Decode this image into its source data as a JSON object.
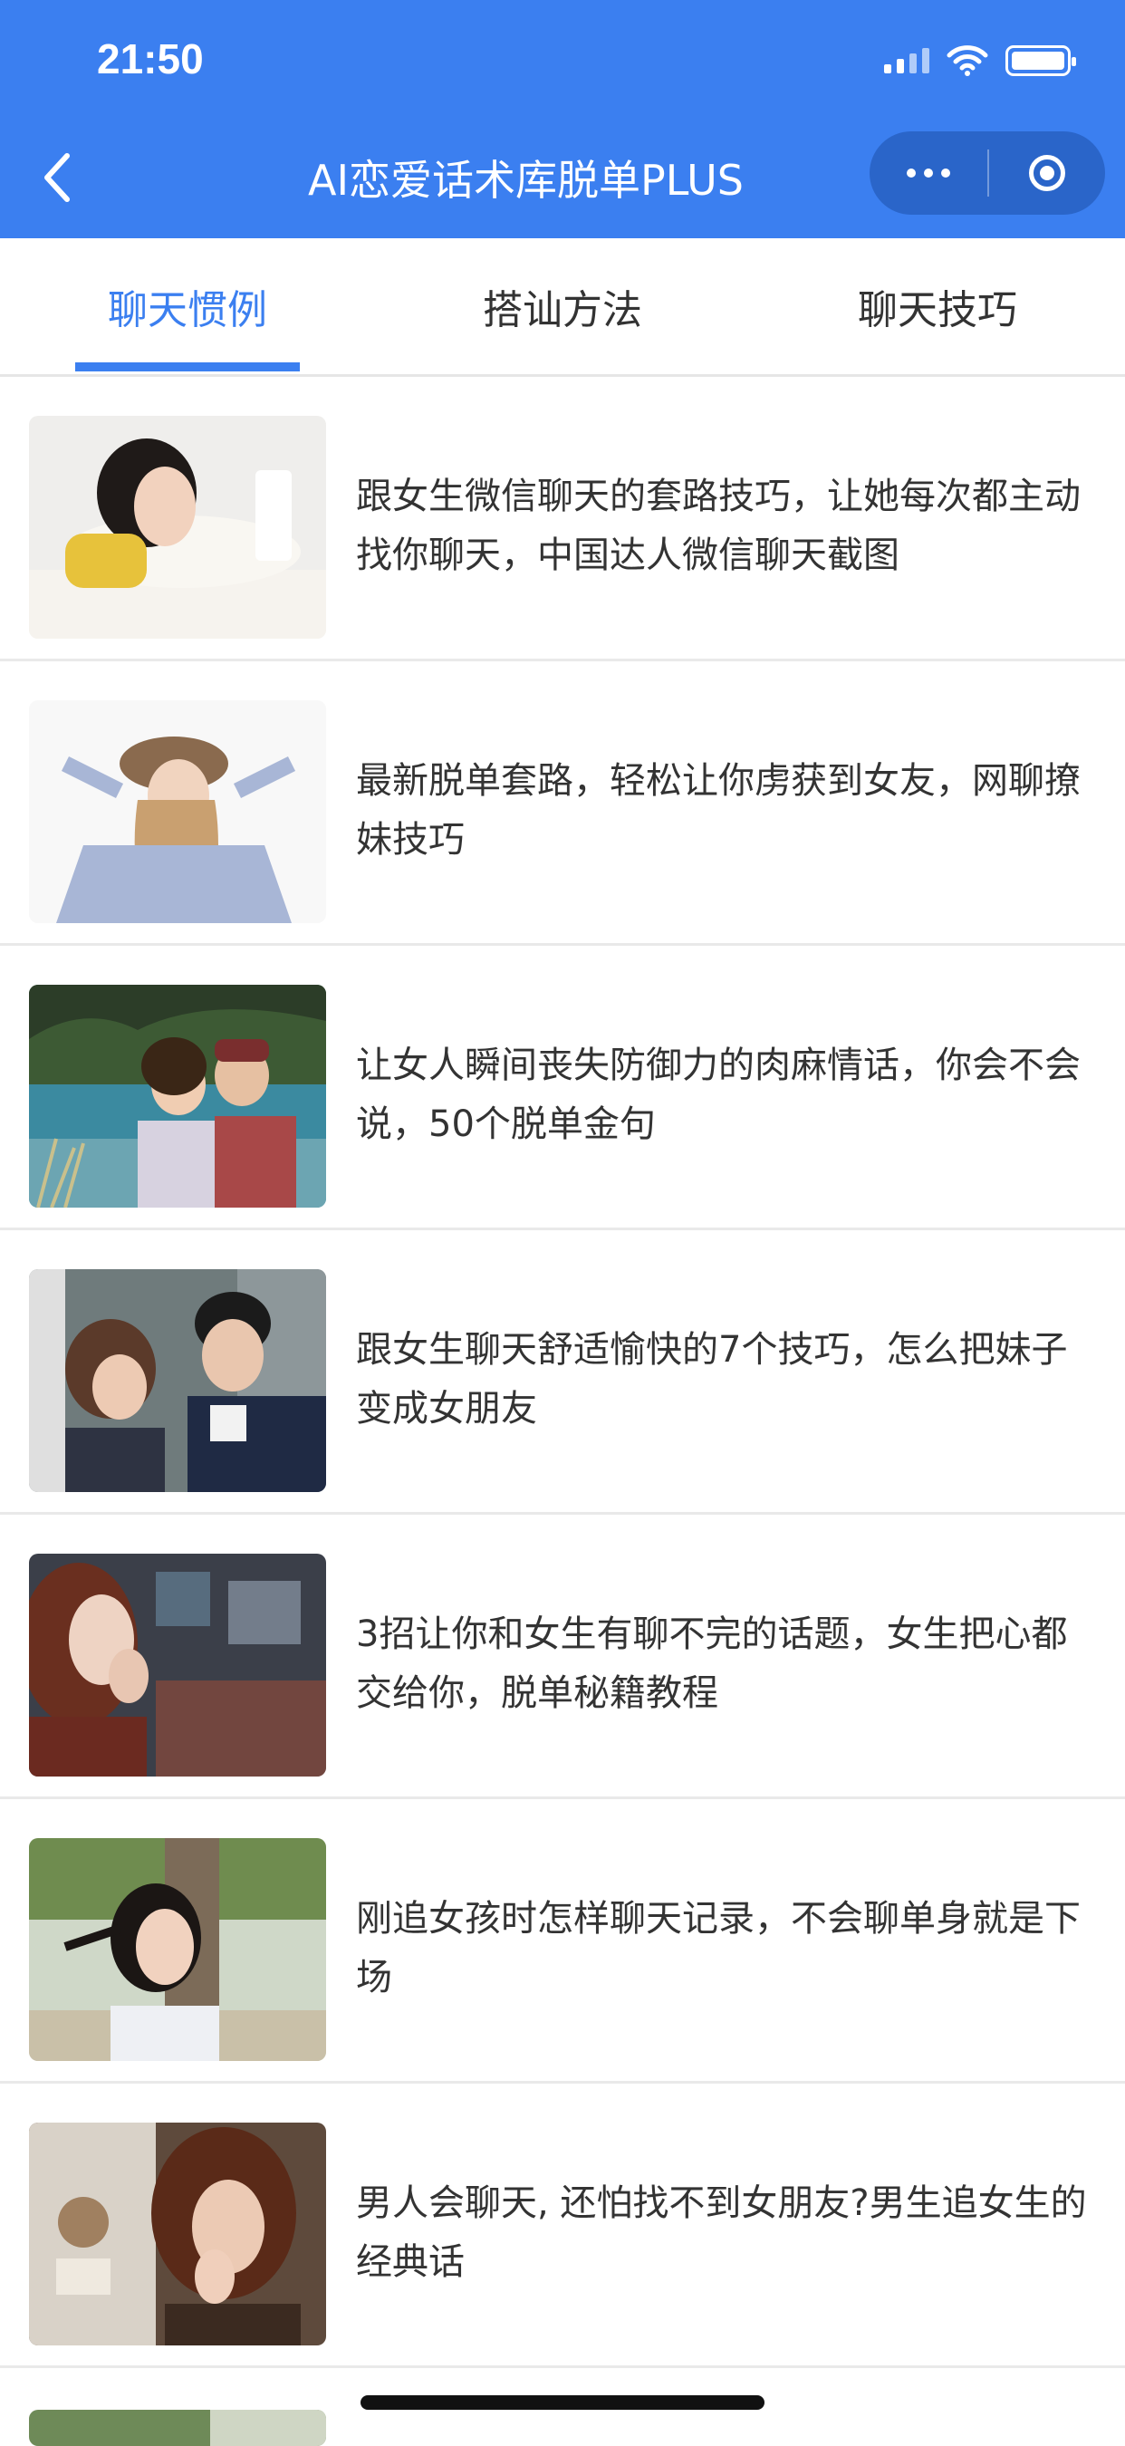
{
  "status_bar": {
    "time": "21:50"
  },
  "nav": {
    "title": "AI恋爱话术库脱单PLUS"
  },
  "tabs": [
    {
      "label": "聊天惯例",
      "active": true
    },
    {
      "label": "搭讪方法",
      "active": false
    },
    {
      "label": "聊天技巧",
      "active": false
    }
  ],
  "articles": [
    {
      "title": "跟女生微信聊天的套路技巧，让她每次都主动找你聊天，中国达人微信聊天截图"
    },
    {
      "title": "最新脱单套路，轻松让你虏获到女友，网聊撩妹技巧"
    },
    {
      "title": "让女人瞬间丧失防御力的肉麻情话，你会不会说，50个脱单金句"
    },
    {
      "title": "跟女生聊天舒适愉快的7个技巧，怎么把妹子变成女朋友"
    },
    {
      "title": "3招让你和女生有聊不完的话题，女生把心都交给你，脱单秘籍教程"
    },
    {
      "title": "刚追女孩时怎样聊天记录，不会聊单身就是下场"
    },
    {
      "title": "男人会聊天, 还怕找不到女朋友?男生追女生的经典话"
    }
  ],
  "colors": {
    "accent": "#3b7ff0",
    "text": "#333333",
    "divider": "#e9e9e9"
  }
}
